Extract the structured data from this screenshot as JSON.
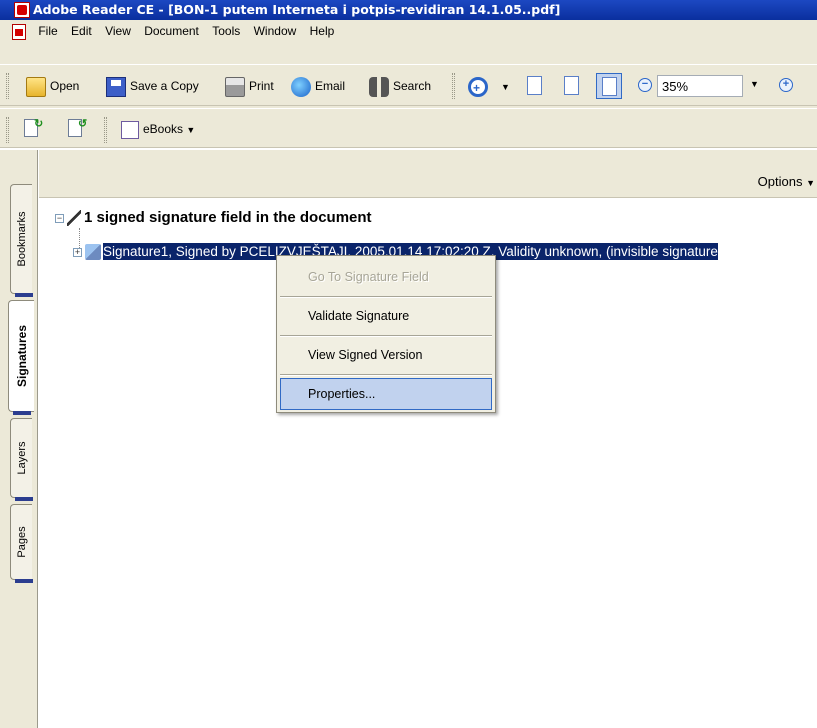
{
  "window": {
    "title": "Adobe Reader CE - [BON-1 putem Interneta i potpis-revidiran 14.1.05..pdf]"
  },
  "menubar": {
    "items": [
      "File",
      "Edit",
      "View",
      "Document",
      "Tools",
      "Window",
      "Help"
    ]
  },
  "toolbar": {
    "open_label": "Open",
    "save_copy_label": "Save a Copy",
    "print_label": "Print",
    "email_label": "Email",
    "search_label": "Search",
    "zoom_value": "35%",
    "ebooks_label": "eBooks"
  },
  "nav_tabs": [
    "Bookmarks",
    "Signatures",
    "Layers",
    "Pages"
  ],
  "active_tab": "Signatures",
  "panel": {
    "options_label": "Options",
    "root_label": "1 signed signature field in the document",
    "signature_label": "Signature1, Signed by PCELIZVJEŠTAJI, 2005.01.14 17:02:20 Z, Validity unknown, (invisible signature"
  },
  "context_menu": {
    "items": [
      {
        "label": "Go To Signature Field",
        "state": "disabled"
      },
      {
        "label": "Validate Signature",
        "state": "normal"
      },
      {
        "label": "View Signed Version",
        "state": "normal"
      },
      {
        "label": "Properties...",
        "state": "hover"
      }
    ]
  },
  "colors": {
    "titlebar": "#0a2f9e",
    "chrome": "#ece9d8",
    "selection": "#0a246a",
    "menu_hover": "#c1d2ee"
  }
}
